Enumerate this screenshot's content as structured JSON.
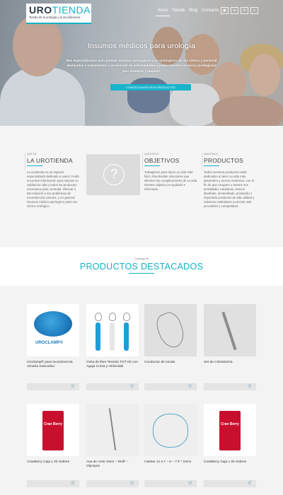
{
  "brand": {
    "logo_bold": "URO",
    "logo_light": "TIENDA",
    "tagline": "Tienda de la urología y la incontinencia",
    "accent_color": "#16b0c8"
  },
  "nav": {
    "items": [
      {
        "label": "Inicio",
        "active": true
      },
      {
        "label": "Tienda",
        "active": false
      },
      {
        "label": "Blog",
        "active": false
      },
      {
        "label": "Contacto",
        "active": false
      }
    ],
    "icons": [
      "cart-icon",
      "user-icon",
      "search-icon",
      "language-icon"
    ]
  },
  "hero": {
    "title": "Insumos médicos para urología",
    "text": "Nos especializamos para proveer insumos quirúrgicos y no quirúrgicos de uso clínico y personal destinados a tratamientos y prevención de enfermedades y padecimientos urinarios (urológicos) para hombres y mujeres.",
    "button_label": "CONOZCA NUESTROS PRODUCTOS"
  },
  "about": {
    "columns": [
      {
        "eyebrow": "QUÉ ES",
        "heading": "LA UROTIENDA",
        "body": "La Urotienda es un espacio especializado dedicado a usted. Podrá encontrar información para mejorar su calidad de vida y todos los productos necesarios para controlar, eliminar o dar solución a sus problemas de Incontinencia Urinaria, y en general insumos médico-quirúrgicos para uso clínico Urológico."
      },
      {
        "eyebrow": "NUESTROS",
        "heading": "OBJETIVOS",
        "body": "Trabajamos para hacer su vida más fácil, ofreciéndole soluciones que eliminen las complicaciones de su vida. Nuestro objetivo es ayudarle e informarle."
      },
      {
        "eyebrow": "NUESTROS",
        "heading": "PRODUCTOS",
        "body": "Todos nuestros productos están dedicados a hacer su vida más placentera y menos restrictiva, con el fin de que recupere y retome sus actividades cotidianas. Hemos diseñado, desarrollado, producido o importado productos de alta calidad y máximos estándares a precios más accesibles y competitivos."
      }
    ]
  },
  "featured": {
    "eyebrow": "Catálogo de",
    "title": "PRODUCTOS DESTACADOS",
    "products": [
      {
        "name": "Uroclamp® para Incontinencia urinaria masculina",
        "img_label": "UROCLAMP®"
      },
      {
        "name": "Cinta de libre Tensión TOT Kit con Aguja Curva y Helicoidal",
        "img_label": ""
      },
      {
        "name": "Conductor de sonda",
        "img_label": ""
      },
      {
        "name": "Set de Cistostomía",
        "img_label": ""
      },
      {
        "name": "CranBerry Caja x 30 Sobres",
        "img_label": "Cran Berry"
      },
      {
        "name": "Asa de corte Storz – Wolf – Olympus",
        "img_label": ""
      },
      {
        "name": "Cateter JJ 4.7 – 6 – 7 fr * 24cm",
        "img_label": ""
      },
      {
        "name": "CranBerry Caja x 30 Sobres",
        "img_label": "Cran Berry"
      }
    ],
    "cart_icon": "cart-icon"
  }
}
